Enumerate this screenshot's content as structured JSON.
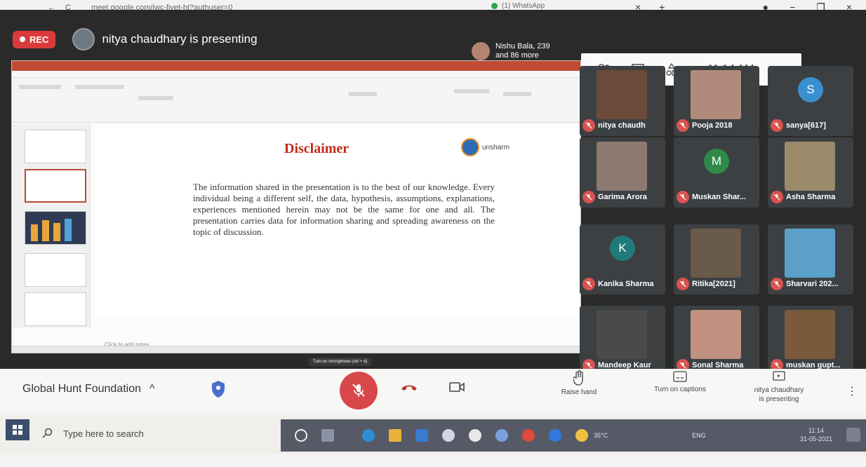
{
  "browser": {
    "url": "meet.google.com/jwc-fivet-ht?authuser=0",
    "tab_label": "(1) WhatsApp",
    "tab_close": "×",
    "new_tab": "+"
  },
  "meet": {
    "rec_label": "REC",
    "presenter_text": "nitya chaudhary is presenting",
    "viewers_text_1": "Nishu Bala, 239",
    "viewers_text_2": "and 86 more",
    "time": "11:14 AM"
  },
  "slide": {
    "title": "Disclaimer",
    "logo_text": "unsharm",
    "body": "The information shared in the presentation is to the best of our knowledge. Every individual being a different self, the data, hypothesis, assumptions, explanations, experiences mentioned herein may not be the same for one and all. The presentation carries data for information sharing and spreading awareness on the topic of discussion.",
    "notes": "Click to add notes"
  },
  "participants": [
    {
      "name": "nitya chaudh",
      "initial": "",
      "color": "#6b4a3a"
    },
    {
      "name": "Pooja 2018",
      "initial": "",
      "color": "#b08a7a"
    },
    {
      "name": "sanya[617]",
      "initial": "S",
      "color": "#3a8fd0"
    },
    {
      "name": "Garima Arora",
      "initial": "",
      "color": "#8c7a70"
    },
    {
      "name": "Muskan Shar...",
      "initial": "M",
      "color": "#2f8a4a"
    },
    {
      "name": "Asha Sharma",
      "initial": "",
      "color": "#9b8a6a"
    },
    {
      "name": "Kanika Sharma",
      "initial": "K",
      "color": "#217a7a"
    },
    {
      "name": "Ritika[2021]",
      "initial": "",
      "color": "#6a5a4a"
    },
    {
      "name": "Sharvari 202...",
      "initial": "",
      "color": "#5aa0c8"
    },
    {
      "name": "Mandeep Kaur",
      "initial": "",
      "color": "#4a4a4a"
    },
    {
      "name": "Sonal Sharma",
      "initial": "",
      "color": "#c09080"
    },
    {
      "name": "muskan gupt...",
      "initial": "",
      "color": "#7a5a3a"
    }
  ],
  "controls": {
    "meeting_name": "Global Hunt Foundation",
    "chevron": "^",
    "tooltip": "Turn on microphone (ctrl + d)",
    "raise_hand": "Raise hand",
    "captions": "Turn on captions",
    "presenting_1": "nitya chaudhary",
    "presenting_2": "is presenting",
    "more": "⋮"
  },
  "taskbar": {
    "search_placeholder": "Type here to search",
    "weather": "35°C",
    "lang": "ENG",
    "clock_time": "11:14",
    "clock_date": "31-05-2021"
  },
  "colors": {
    "dark": "#2a2a2a",
    "mute_red": "#d9534f",
    "ppt_red": "#c14b32",
    "slide_title": "#c02e1c"
  }
}
